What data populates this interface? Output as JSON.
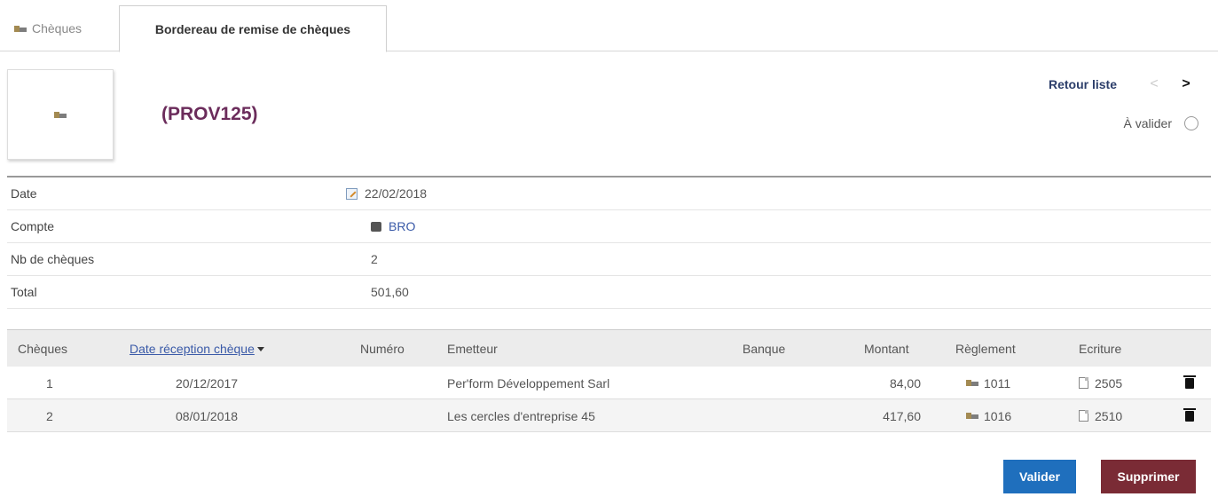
{
  "tabs": [
    {
      "label": "Chèques",
      "icon": "cheque-icon",
      "active": false
    },
    {
      "label": "Bordereau de remise de chèques",
      "active": true
    }
  ],
  "header": {
    "reference": "(PROV125)",
    "back_label": "Retour liste",
    "prev_icon": "chevron-left-icon",
    "next_icon": "chevron-right-icon",
    "status_label": "À valider",
    "ref_color": "#6b2c5b"
  },
  "fields": [
    {
      "label": "Date",
      "value": "22/02/2018",
      "icon": "edit-icon"
    },
    {
      "label": "Compte",
      "value": "BRO",
      "icon": "bank-icon"
    },
    {
      "label": "Nb de chèques",
      "value": "2"
    },
    {
      "label": "Total",
      "value": "501,60"
    }
  ],
  "table": {
    "columns": [
      "Chèques",
      "Date réception chèque",
      "Numéro",
      "Emetteur",
      "Banque",
      "Montant",
      "Règlement",
      "Ecriture"
    ],
    "rows": [
      {
        "num": "1",
        "date": "20/12/2017",
        "numero": "",
        "emetteur": "Per'form Développement Sarl",
        "banque": "",
        "montant": "84,00",
        "reglement": "1011",
        "ecriture": "2505"
      },
      {
        "num": "2",
        "date": "08/01/2018",
        "numero": "",
        "emetteur": "Les cercles d'entreprise 45",
        "banque": "",
        "montant": "417,60",
        "reglement": "1016",
        "ecriture": "2510"
      }
    ]
  },
  "buttons": {
    "validate": "Valider",
    "delete": "Supprimer",
    "validate_color": "#1f6fbd",
    "delete_color": "#7a2b35"
  }
}
